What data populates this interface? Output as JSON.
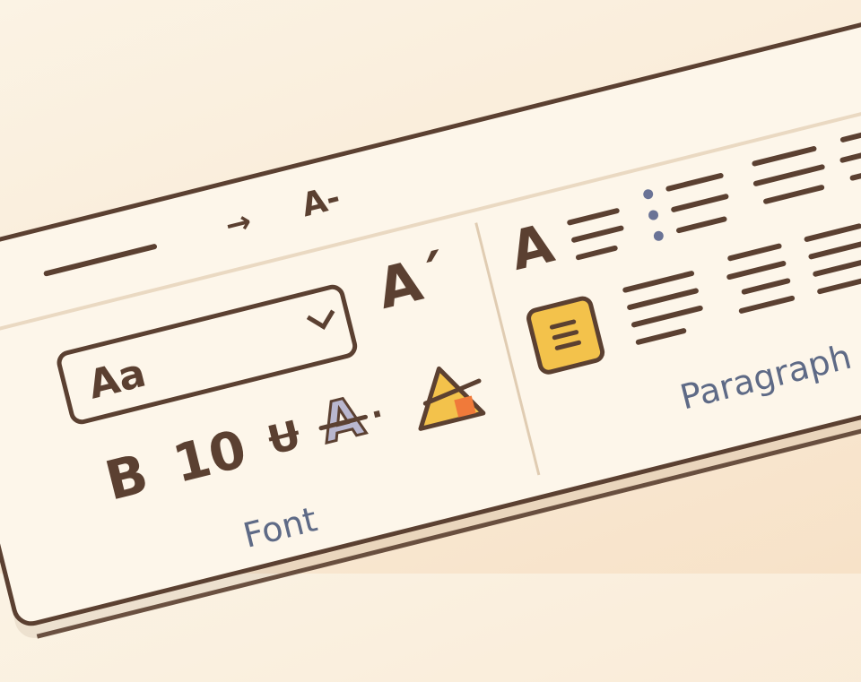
{
  "colors": {
    "ink": "#5b4031",
    "label": "#5e6a86",
    "panel": "#fdf6ea",
    "accent_yellow": "#f3c24b",
    "accent_orange": "#f07a3a",
    "clear_format_fill": "#b9b7cf"
  },
  "title_bar": {
    "arrow_glyph": "→",
    "text_style_glyph": "A-"
  },
  "font_group": {
    "label": "Font",
    "font_name_select": {
      "value": "Aa",
      "icon": "chevron-down-icon"
    },
    "grow_font_glyph": "A´",
    "bold_glyph": "B",
    "font_size_value": "10",
    "underline_glyph": "Ʉ",
    "clear_formatting_glyph": "A",
    "clear_formatting_suffix": "·",
    "text_highlight_glyph": "A"
  },
  "paragraph_group": {
    "label": "Paragraph",
    "style_glyph": "A",
    "icons": [
      "align-left-icon",
      "bullet-list-icon",
      "align-center-icon",
      "indent-icon",
      "shading-icon",
      "justify-icon",
      "align-right-icon",
      "line-spacing-icon"
    ]
  }
}
